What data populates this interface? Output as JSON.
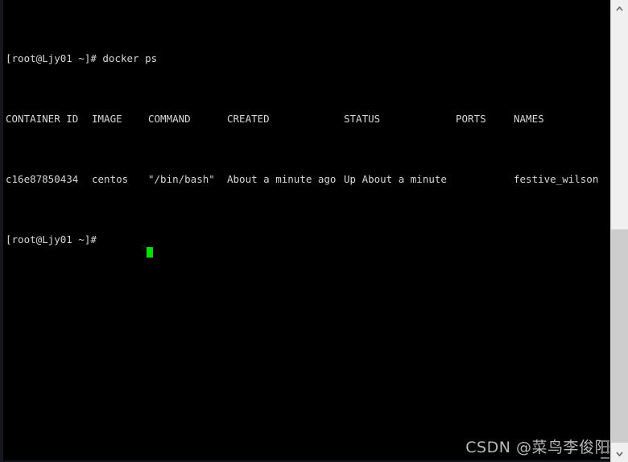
{
  "window": {
    "type": "terminal",
    "background_color": "#000000",
    "text_color": "#d8d8d8",
    "cursor_color": "#00e000"
  },
  "terminal": {
    "prompt_line": "[root@Ljy01 ~]# docker ps",
    "final_prompt": "[root@Ljy01 ~]# ",
    "table": {
      "headers": [
        "CONTAINER ID",
        "IMAGE",
        "COMMAND",
        "CREATED",
        "STATUS",
        "PORTS",
        "NAMES"
      ],
      "rows": [
        {
          "container_id": "c16e87850434",
          "image": "centos",
          "command": "\"/bin/bash\"",
          "created": "About a minute ago",
          "status": "Up About a minute",
          "ports": "",
          "names": "festive_wilson"
        }
      ]
    }
  },
  "scrollbar": {
    "up_arrow_icon": "chevron-up-icon",
    "down_arrow_icon": "chevron-down-icon",
    "track_color": "#f0f0f0",
    "thumb_color": "#cdcdcd"
  },
  "watermark": {
    "text": "CSDN @菜鸟李俊阳"
  }
}
